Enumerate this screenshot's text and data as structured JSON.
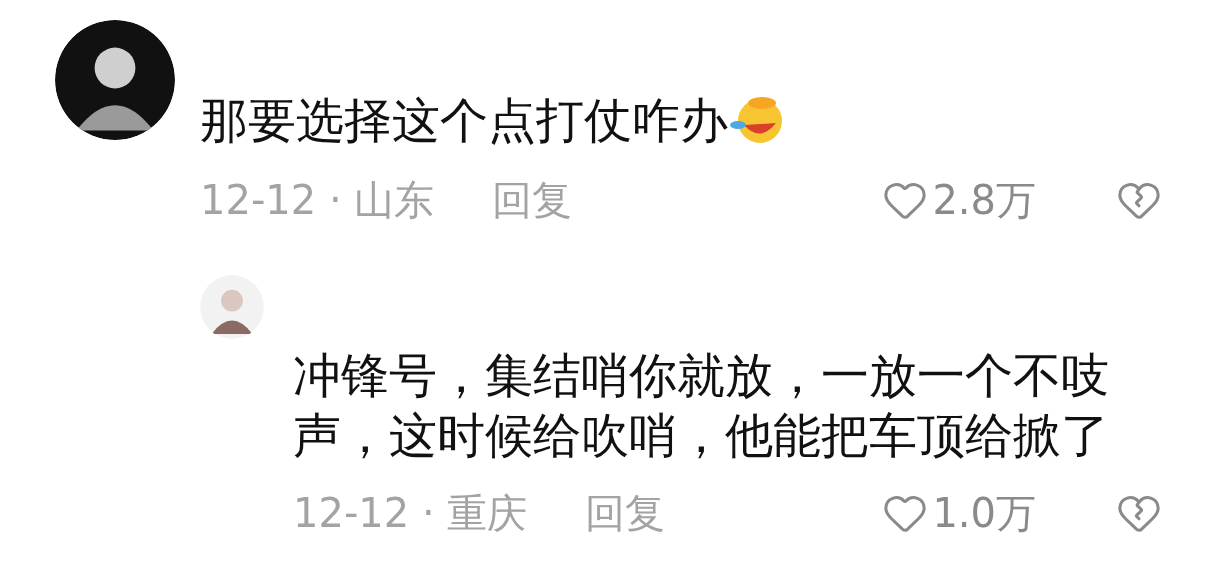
{
  "comments": [
    {
      "text": "那要选择这个点打仗咋办",
      "emoji": true,
      "meta": "12-12 · 山东",
      "reply": "回复",
      "likes": "2.8万",
      "replies": [
        {
          "text": "冲锋号，集结哨你就放，一放一个不吱声，这时候给吹哨，他能把车顶给掀了",
          "meta": "12-12 · 重庆",
          "reply": "回复",
          "likes": "1.0万"
        }
      ]
    }
  ]
}
